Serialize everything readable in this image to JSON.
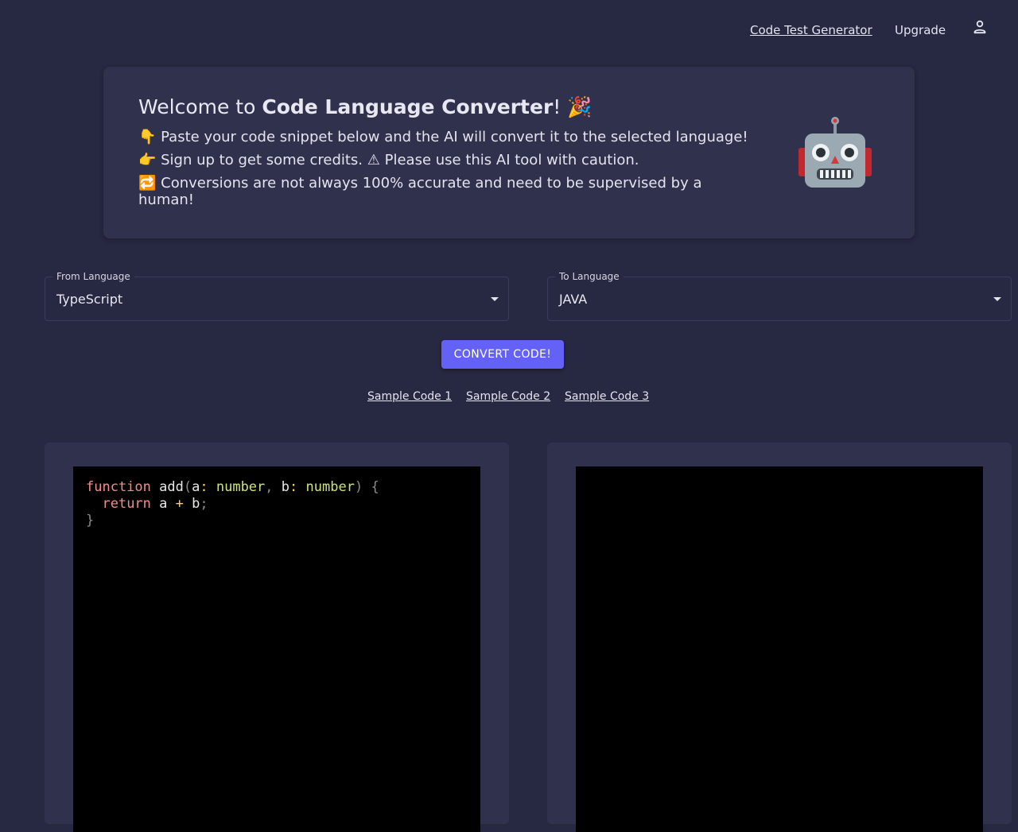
{
  "nav": {
    "links": [
      {
        "label": "Code Test Generator"
      },
      {
        "label": "Upgrade"
      }
    ],
    "account_icon": "person-icon"
  },
  "welcome": {
    "title_prefix": "Welcome to ",
    "title_bold": "Code Language Converter",
    "title_suffix": "! 🎉",
    "lines": [
      "👇 Paste your code snippet below and the AI will convert it to the selected language!",
      "👉 Sign up to get some credits. ⚠ Please use this AI tool with caution.",
      "🔁 Conversions are not always 100% accurate and need to be supervised by a human!"
    ],
    "robot_icon": "robot-icon"
  },
  "from_select": {
    "label": "From Language",
    "value": "TypeScript"
  },
  "to_select": {
    "label": "To Language",
    "value": "JAVA"
  },
  "convert_button": {
    "label": "CONVERT CODE!"
  },
  "samples": [
    {
      "label": "Sample Code 1"
    },
    {
      "label": "Sample Code 2"
    },
    {
      "label": "Sample Code 3"
    }
  ],
  "input_code": {
    "lines": [
      "function add(a: number, b: number) {",
      "  return a + b;",
      "}"
    ]
  },
  "output_code": {
    "lines": []
  },
  "colors": {
    "background": "#272841",
    "card": "#30314d",
    "accent": "#6462f6",
    "code_bg": "#000000",
    "keyword": "#f08d8d",
    "type": "#cce37a",
    "operator": "#ffd34d"
  }
}
